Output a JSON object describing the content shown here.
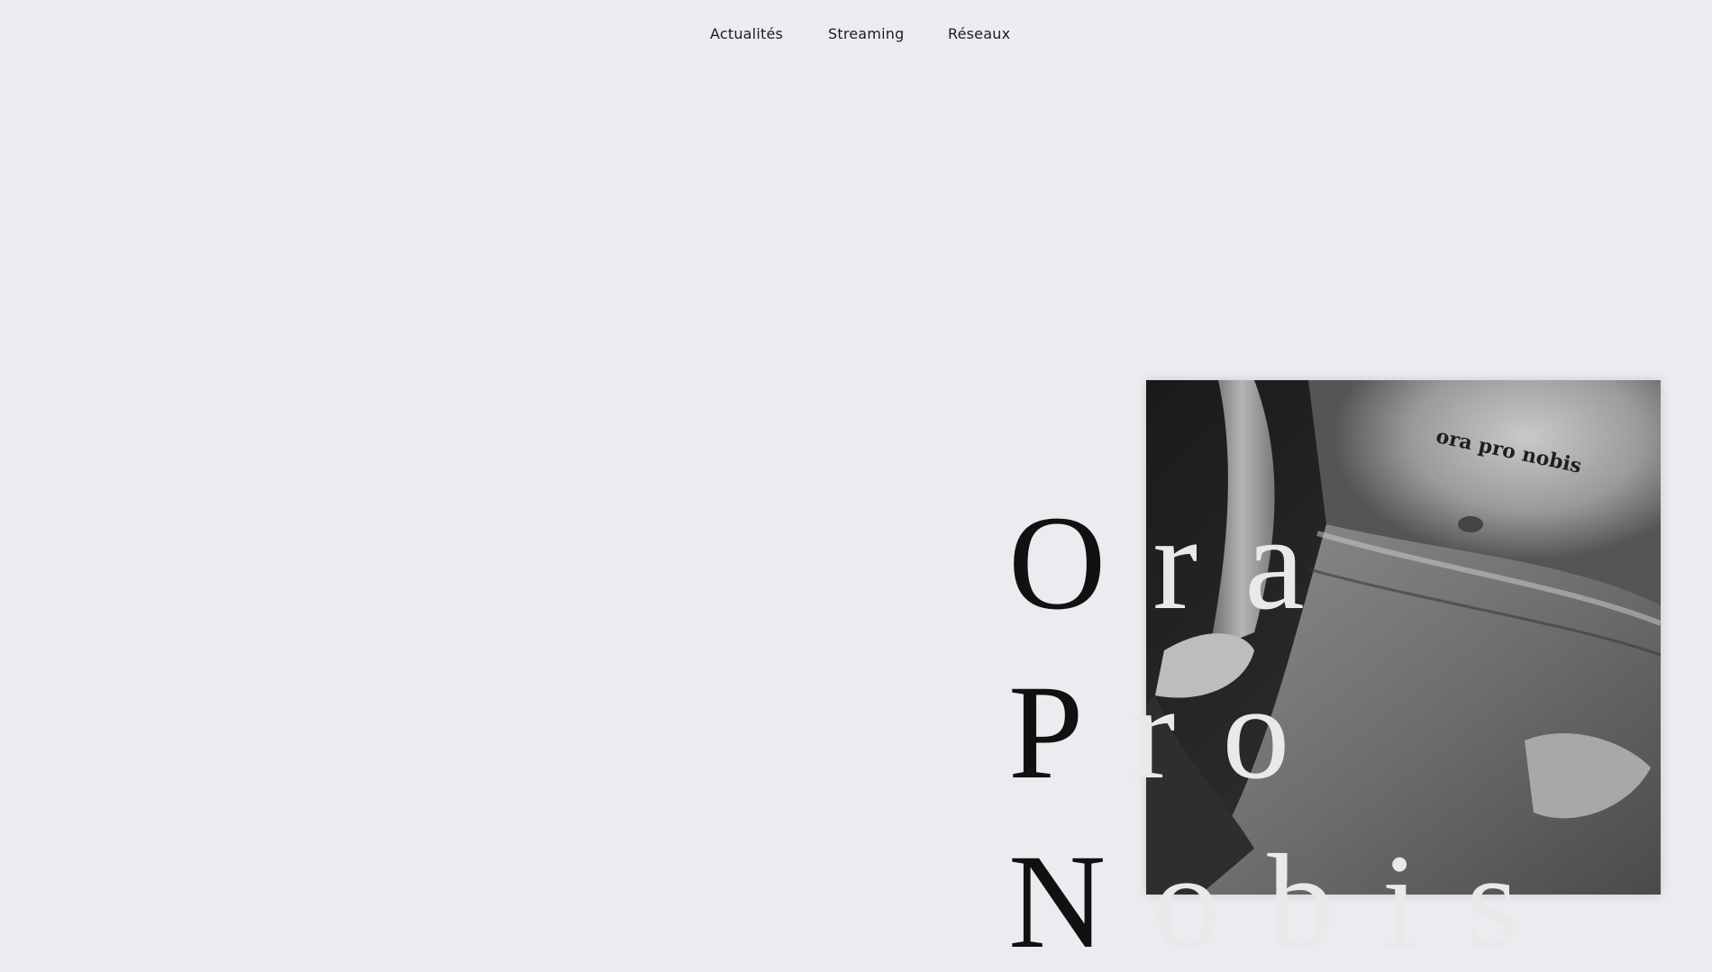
{
  "nav": {
    "items": [
      {
        "label": "Actualités"
      },
      {
        "label": "Streaming"
      },
      {
        "label": "Réseaux"
      }
    ]
  },
  "hero": {
    "title_lines": [
      "Ora",
      "Pro",
      "Nobis"
    ],
    "cover_tattoo_text": "ora pro nobis"
  },
  "colors": {
    "background": "#ebecef",
    "text": "#111111"
  }
}
